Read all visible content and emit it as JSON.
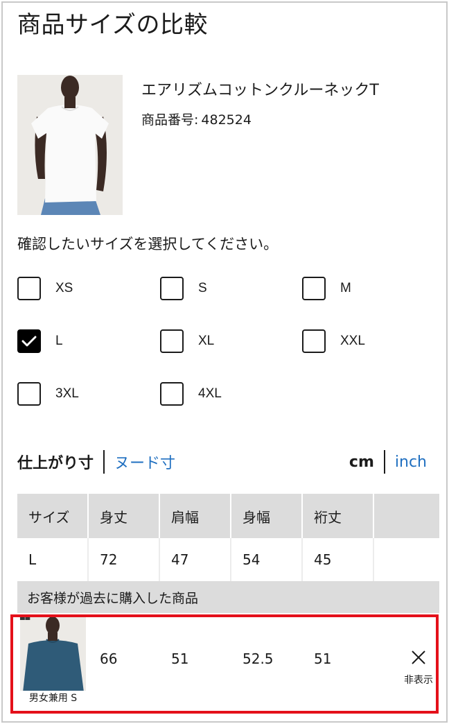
{
  "title": "商品サイズの比較",
  "product": {
    "name": "エアリズムコットンクルーネックT",
    "number_label": "商品番号:",
    "number": "482524"
  },
  "prompt": "確認したいサイズを選択してください。",
  "sizes": [
    {
      "label": "XS",
      "checked": false
    },
    {
      "label": "S",
      "checked": false
    },
    {
      "label": "M",
      "checked": false
    },
    {
      "label": "L",
      "checked": true
    },
    {
      "label": "XL",
      "checked": false
    },
    {
      "label": "XXL",
      "checked": false
    },
    {
      "label": "3XL",
      "checked": false
    },
    {
      "label": "4XL",
      "checked": false
    }
  ],
  "measure_tabs": {
    "finished": "仕上がり寸",
    "nude": "ヌード寸"
  },
  "units": {
    "cm": "cm",
    "inch": "inch"
  },
  "table": {
    "headers": [
      "サイズ",
      "身丈",
      "肩幅",
      "身幅",
      "裄丈",
      ""
    ],
    "row": [
      "L",
      "72",
      "47",
      "54",
      "45",
      ""
    ],
    "purchased_title": "お客様が過去に購入した商品",
    "purchased": {
      "caption": "男女兼用 S",
      "values": [
        "66",
        "51",
        "52.5",
        "51"
      ],
      "hide_label": "非表示"
    }
  }
}
